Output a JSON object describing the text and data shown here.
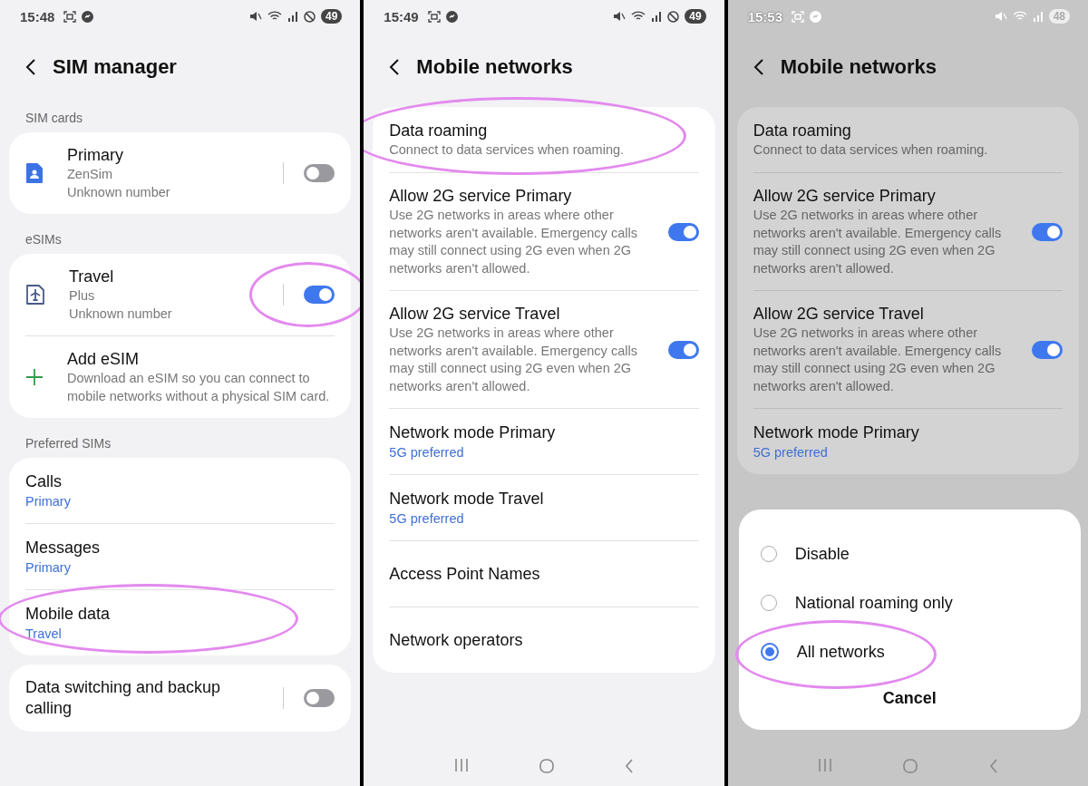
{
  "panels": [
    {
      "kind": "sim_manager",
      "dimmed": false,
      "status": {
        "time": "15:48",
        "battery": "49"
      },
      "title": "SIM manager",
      "groups": [
        {
          "header": "SIM cards",
          "items": [
            {
              "kind": "physical_sim",
              "title": "Primary",
              "lines": [
                "ZenSim",
                "Unknown number"
              ],
              "on": false,
              "highlighted": false
            }
          ]
        },
        {
          "header": "eSIMs",
          "items": [
            {
              "kind": "esim",
              "title": "Travel",
              "lines": [
                "Plus",
                "Unknown number"
              ],
              "on": true,
              "highlighted": true
            },
            {
              "kind": "add",
              "title": "Add eSIM",
              "description": "Download an eSIM so you can connect to mobile networks without a physical SIM card.",
              "highlighted": false
            }
          ]
        },
        {
          "header": "Preferred SIMs",
          "items": [
            {
              "kind": "value",
              "title": "Calls",
              "value": "Primary",
              "highlighted": false
            },
            {
              "kind": "value",
              "title": "Messages",
              "value": "Primary",
              "highlighted": false
            },
            {
              "kind": "value",
              "title": "Mobile data",
              "value": "Travel",
              "highlighted": true
            }
          ]
        },
        {
          "items": [
            {
              "kind": "switch",
              "title": "Data switching and backup calling",
              "on": false,
              "highlighted": false
            }
          ]
        }
      ]
    },
    {
      "kind": "mobile_networks",
      "dimmed": false,
      "status": {
        "time": "15:49",
        "battery": "49"
      },
      "title": "Mobile networks",
      "groups": [
        {
          "items": [
            {
              "kind": "detail",
              "title": "Data roaming",
              "description": "Connect to data services when roaming.",
              "highlighted": true
            },
            {
              "kind": "switch",
              "title": "Allow 2G service Primary",
              "description": "Use 2G networks in areas where other networks aren't available. Emergency calls may still connect using 2G even when 2G networks aren't allowed.",
              "on": true,
              "highlighted": false
            },
            {
              "kind": "switch",
              "title": "Allow 2G service Travel",
              "description": "Use 2G networks in areas where other networks aren't available. Emergency calls may still connect using 2G even when 2G networks aren't allowed.",
              "on": true,
              "highlighted": false
            },
            {
              "kind": "value",
              "title": "Network mode Primary",
              "value": "5G preferred",
              "highlighted": false
            },
            {
              "kind": "value",
              "title": "Network mode Travel",
              "value": "5G preferred",
              "highlighted": false
            },
            {
              "kind": "plain",
              "title": "Access Point Names",
              "highlighted": false
            },
            {
              "kind": "plain",
              "title": "Network operators",
              "highlighted": false
            }
          ]
        }
      ]
    },
    {
      "kind": "mobile_networks",
      "dimmed": true,
      "status": {
        "time": "15:53",
        "battery": "48"
      },
      "title": "Mobile networks",
      "groups": [
        {
          "items": [
            {
              "kind": "detail",
              "title": "Data roaming",
              "description": "Connect to data services when roaming.",
              "highlighted": false
            },
            {
              "kind": "switch",
              "title": "Allow 2G service Primary",
              "description": "Use 2G networks in areas where other networks aren't available. Emergency calls may still connect using 2G even when 2G networks aren't allowed.",
              "on": true,
              "highlighted": false
            },
            {
              "kind": "switch",
              "title": "Allow 2G service Travel",
              "description": "Use 2G networks in areas where other networks aren't available. Emergency calls may still connect using 2G even when 2G networks aren't allowed.",
              "on": true,
              "highlighted": false
            },
            {
              "kind": "value",
              "title": "Network mode Primary",
              "value": "5G preferred",
              "highlighted": false
            }
          ]
        }
      ],
      "dialog": {
        "options": [
          {
            "label": "Disable",
            "selected": false,
            "highlighted": false
          },
          {
            "label": "National roaming only",
            "selected": false,
            "highlighted": false
          },
          {
            "label": "All networks",
            "selected": true,
            "highlighted": true
          }
        ],
        "cancel": "Cancel"
      }
    }
  ]
}
